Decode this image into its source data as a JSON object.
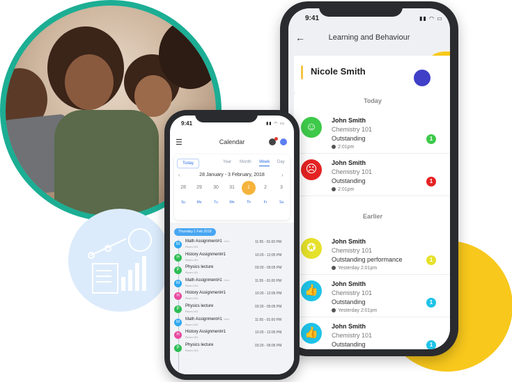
{
  "colors": {
    "teal_ring": "#1cae94",
    "yellow_accent": "#f8c81c",
    "light_blue_bg": "#dcebfb",
    "purple_accent": "#3f3fc8",
    "calendar_blue": "#2f6fe0",
    "selected_day": "#f6b33c"
  },
  "learning_phone": {
    "status_time": "9:41",
    "title": "Learning and Behaviour",
    "student_name": "Nicole Smith",
    "sections": {
      "today": "Today",
      "earlier": "Earlier"
    },
    "today_items": [
      {
        "name": "John Smith",
        "subject": "Chemistry 101",
        "rating": "Outstanding",
        "time": "2:01pm",
        "count": "1",
        "icon": "smiley-icon",
        "face_color": "#3ec94a",
        "count_color": "#3ec94a"
      },
      {
        "name": "John Smith",
        "subject": "Chemistry 101",
        "rating": "Outstanding",
        "time": "2:01pm",
        "count": "1",
        "icon": "angry-face-icon",
        "face_color": "#e52222",
        "count_color": "#e52222"
      }
    ],
    "earlier_items": [
      {
        "name": "John Smith",
        "subject": "Chemistry 101",
        "rating": "Outstanding performance",
        "time": "Yesterday 2:01pm",
        "count": "1",
        "icon": "award-ribbon-icon",
        "face_color": "#e6e12a",
        "count_color": "#e6e12a"
      },
      {
        "name": "John Smith",
        "subject": "Chemistry 101",
        "rating": "Outstanding",
        "time": "Yesterday 2:01pm",
        "count": "1",
        "icon": "thumbs-up-icon",
        "face_color": "#1fc3e8",
        "count_color": "#1fc3e8"
      },
      {
        "name": "John Smith",
        "subject": "Chemistry 101",
        "rating": "Outstanding",
        "time": "",
        "count": "1",
        "icon": "thumbs-up-icon",
        "face_color": "#1fc3e8",
        "count_color": "#1fc3e8"
      }
    ]
  },
  "calendar_phone": {
    "status_time": "9:41",
    "title": "Calendar",
    "tabs": [
      "Today",
      "Year",
      "Month",
      "Week",
      "Day"
    ],
    "active_tab": "Week",
    "range": "28 January - 3 February, 2018",
    "days": [
      "28",
      "29",
      "30",
      "31",
      "1",
      "2",
      "3"
    ],
    "selected_day": "1",
    "weekdays": [
      "Su",
      "Mo",
      "Tu",
      "We",
      "Th",
      "Fr",
      "Sa"
    ],
    "agenda_date": "Thursday 1 Feb 2018",
    "agenda": [
      {
        "title": "Math Assignment#1",
        "who": "John",
        "room": "Room 101",
        "time": "11:55 - 01:00 PM",
        "color": "#2fa8f0",
        "icon": "M"
      },
      {
        "title": "History Assignment#1",
        "who": "",
        "room": "Room 101",
        "time": "10:20 - 12:05 PM",
        "color": "#2ebd55",
        "icon": "H"
      },
      {
        "title": "Physics lecture",
        "who": "",
        "room": "Room 101",
        "time": "03:20 - 05:05 PM",
        "color": "#2ebd55",
        "icon": "P"
      },
      {
        "title": "Math Assignment#1",
        "who": "John",
        "room": "Room 101",
        "time": "11:55 - 01:00 PM",
        "color": "#2fa8f0",
        "icon": "M"
      },
      {
        "title": "History Assignment#1",
        "who": "",
        "room": "Room 101",
        "time": "10:20 - 12:05 PM",
        "color": "#e94aa0",
        "icon": "H"
      },
      {
        "title": "Physics lecture",
        "who": "",
        "room": "Room 101",
        "time": "03:20 - 05:05 PM",
        "color": "#2ebd55",
        "icon": "P"
      },
      {
        "title": "Math Assignment#1",
        "who": "John",
        "room": "Room 101",
        "time": "11:55 - 01:00 PM",
        "color": "#2fa8f0",
        "icon": "M"
      },
      {
        "title": "History Assignment#1",
        "who": "",
        "room": "Room 101",
        "time": "10:20 - 12:05 PM",
        "color": "#e94aa0",
        "icon": "H"
      },
      {
        "title": "Physics lecture",
        "who": "",
        "room": "Room 101",
        "time": "03:20 - 05:05 PM",
        "color": "#2ebd55",
        "icon": "P"
      }
    ]
  }
}
